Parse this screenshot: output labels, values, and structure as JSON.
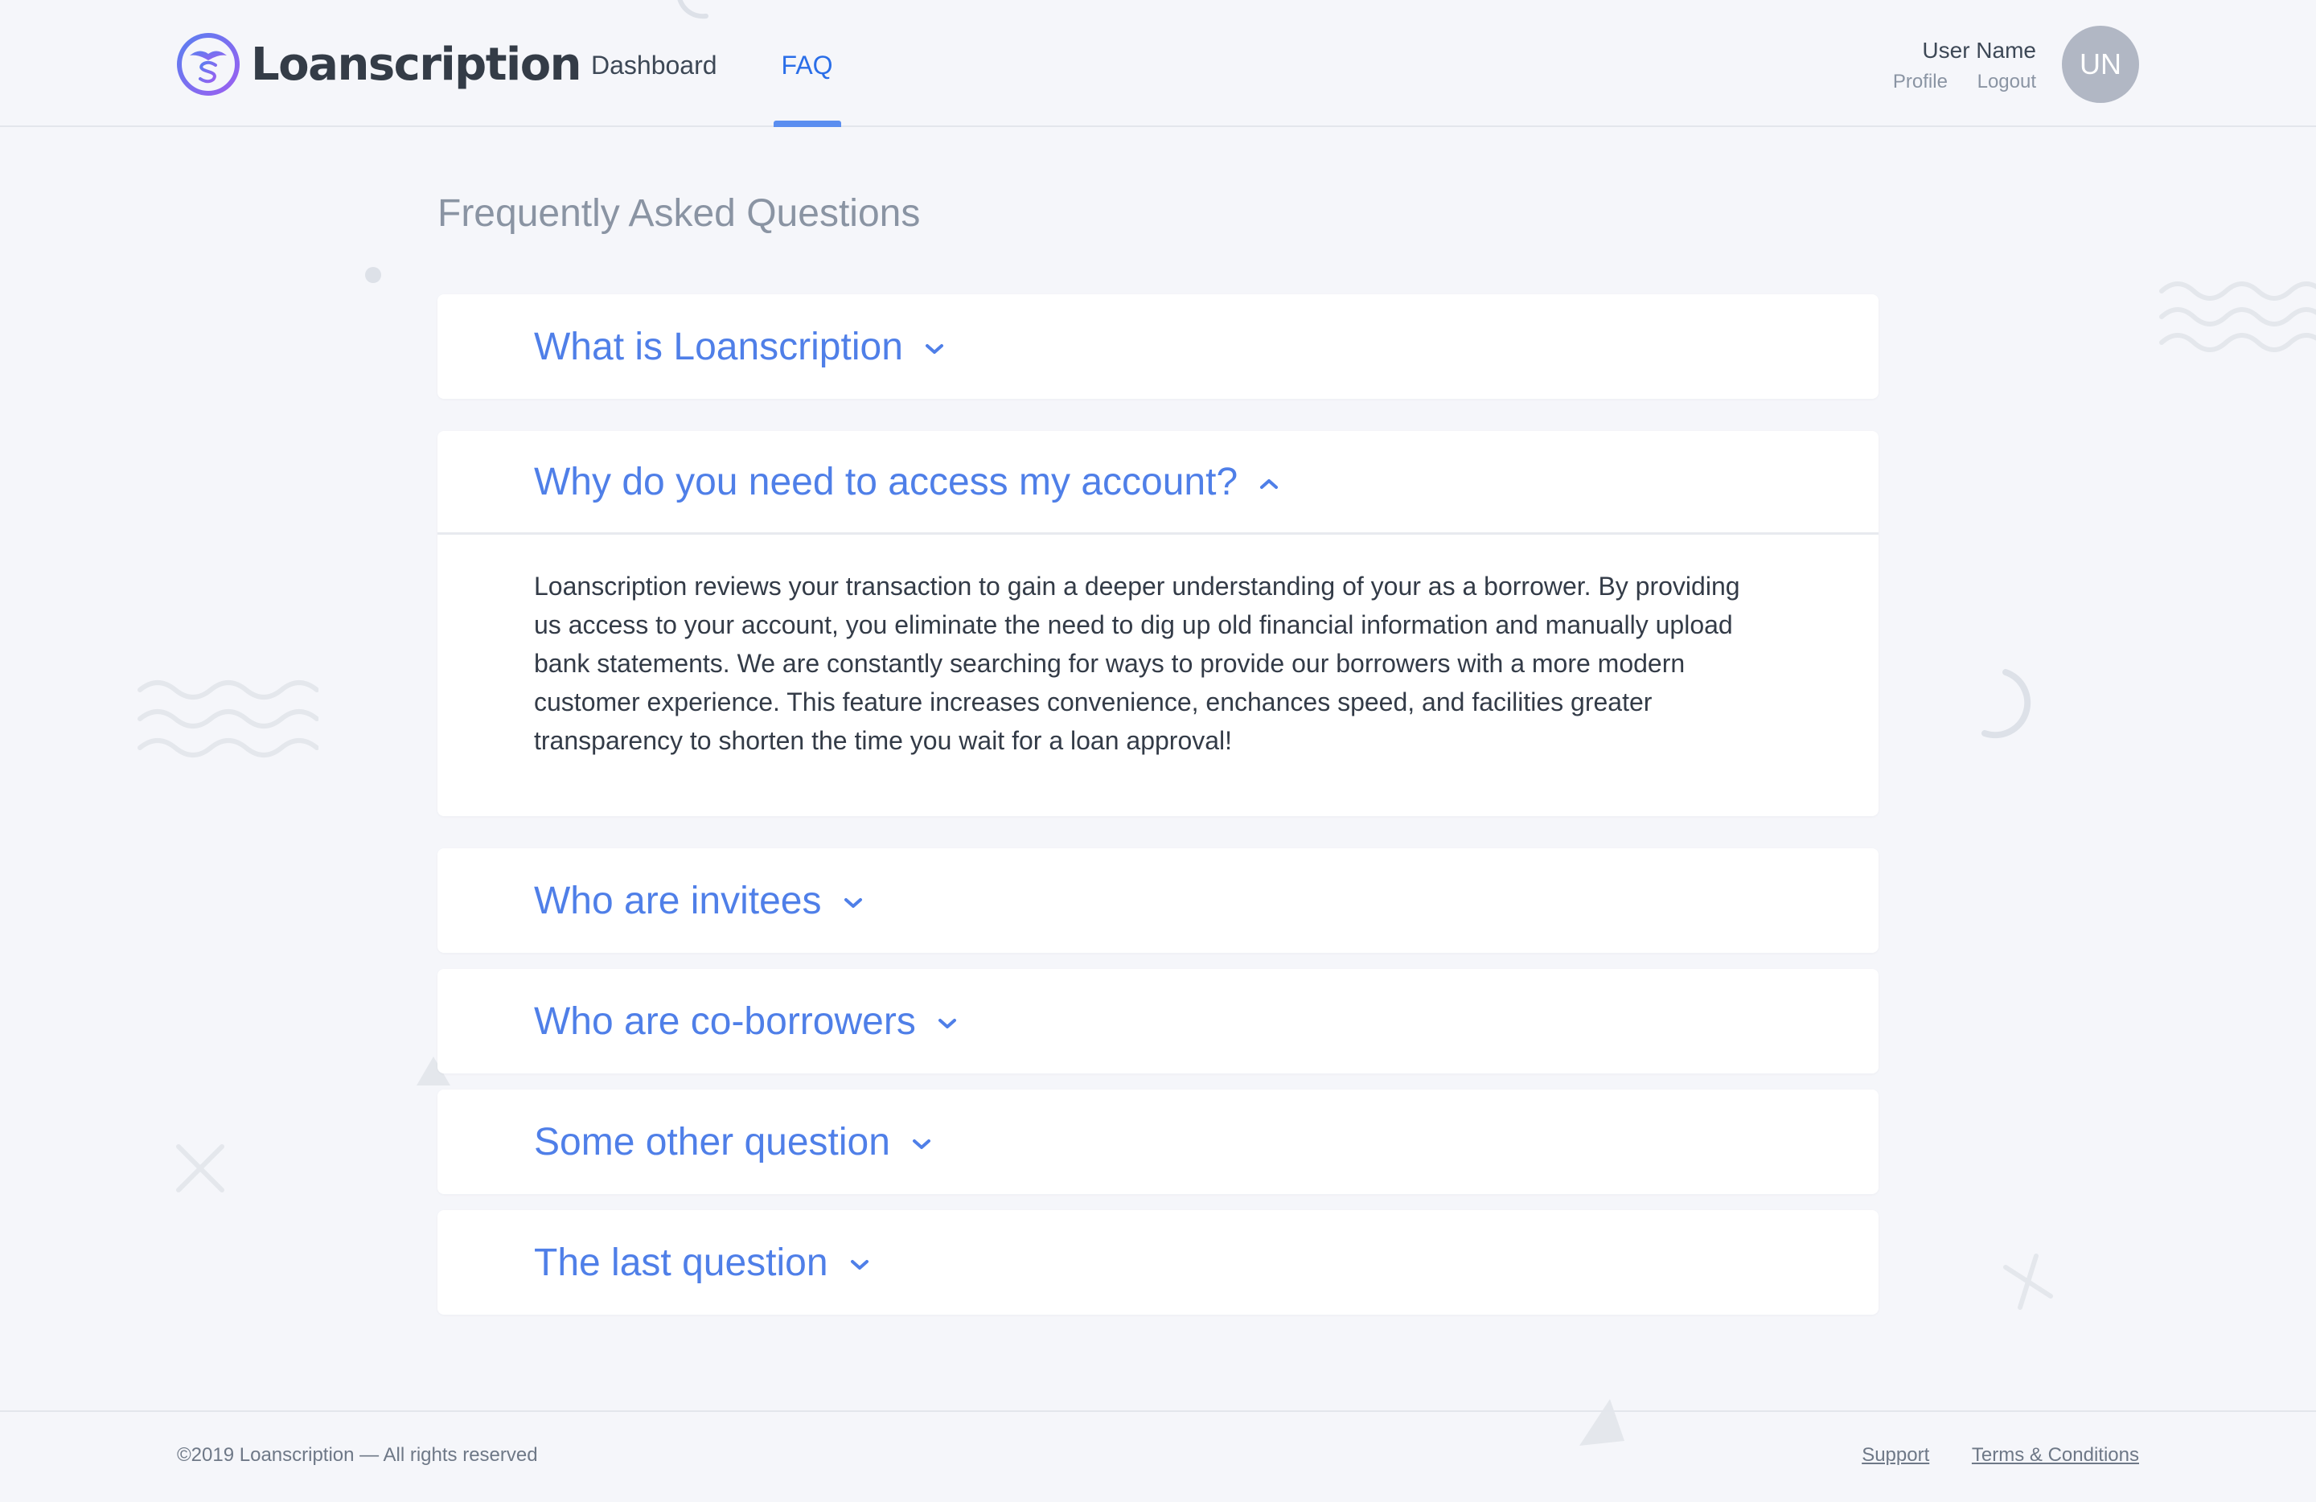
{
  "brand": {
    "name": "Loanscription",
    "accent_color": "#4f7fe8",
    "logo_gradient": [
      "#5b7ff0",
      "#9b5ff0"
    ]
  },
  "nav": {
    "items": [
      {
        "label": "Dashboard",
        "active": false
      },
      {
        "label": "FAQ",
        "active": true
      }
    ]
  },
  "user": {
    "name": "User Name",
    "profile_label": "Profile",
    "logout_label": "Logout",
    "initials": "UN"
  },
  "page": {
    "title": "Frequently Asked Questions"
  },
  "faq": [
    {
      "question": "What is Loanscription",
      "open": false,
      "icon": "chevron-down-icon"
    },
    {
      "question": "Why do you need to access my account?",
      "open": true,
      "icon": "chevron-up-icon",
      "answer": "Loanscription reviews your transaction to gain a deeper understanding of your as a borrower. By providing us access to your account, you eliminate the need to dig up old financial information and manually upload bank statements. We are constantly searching for ways to provide our borrowers with a more modern customer experience. This feature increases convenience, enchances speed, and facilities greater transparency to shorten the time you wait for a loan approval!"
    },
    {
      "question": "Who are invitees",
      "open": false,
      "icon": "chevron-down-icon"
    },
    {
      "question": "Who are co-borrowers",
      "open": false,
      "icon": "chevron-down-icon"
    },
    {
      "question": "Some other question",
      "open": false,
      "icon": "chevron-down-icon"
    },
    {
      "question": "The last question",
      "open": false,
      "icon": "chevron-down-icon"
    }
  ],
  "footer": {
    "copyright": "©2019 Loanscription — All rights reserved",
    "links": [
      "Support",
      "Terms & Conditions"
    ]
  }
}
